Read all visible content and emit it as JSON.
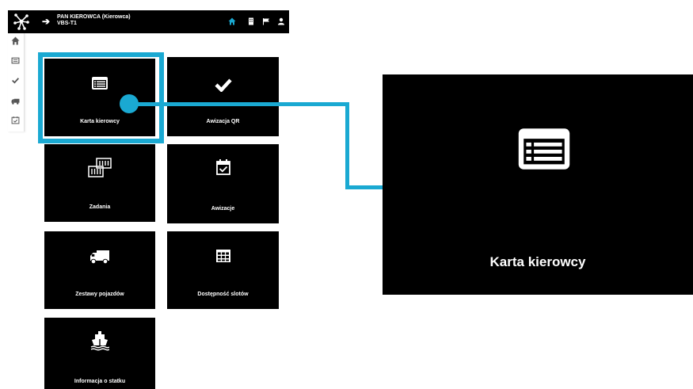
{
  "header": {
    "user_name": "PAN KIEROWCA (Kierowca)",
    "unit_code": "VBS-T1",
    "logo_icon": "network-logo-icon",
    "back_icon": "arrow-right-icon",
    "actions": [
      "home-icon",
      "building-icon",
      "flag-icon",
      "user-icon"
    ],
    "accent_color": "#1aa9d2"
  },
  "sidebar": {
    "icons": [
      "home-icon",
      "card-icon",
      "check-icon",
      "truck-icon",
      "calendar-check-icon"
    ]
  },
  "tiles": [
    {
      "label": "Karta kierowcy",
      "icon": "id-card-icon"
    },
    {
      "label": "Awizacja QR",
      "icon": "check-icon"
    },
    {
      "label": "Zadania",
      "icon": "containers-icon"
    },
    {
      "label": "Awizacje",
      "icon": "calendar-check-icon"
    },
    {
      "label": "Zestawy pojazdów",
      "icon": "truck-icon"
    },
    {
      "label": "Dostępność slotów",
      "icon": "table-grid-icon"
    },
    {
      "label": "Informacja o statku",
      "icon": "ship-icon"
    }
  ],
  "zoom": {
    "label": "Karta kierowcy",
    "icon": "id-card-icon"
  }
}
